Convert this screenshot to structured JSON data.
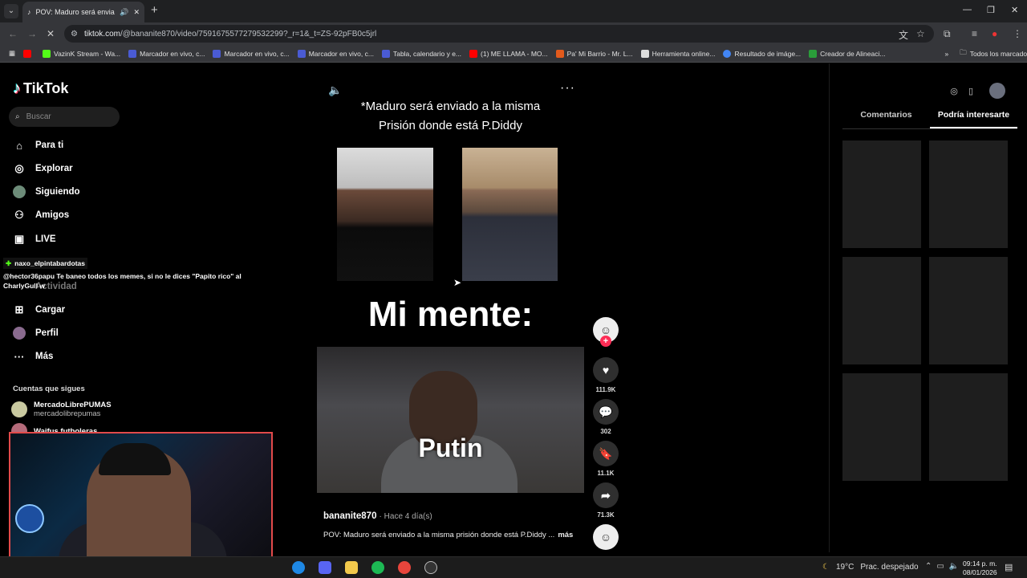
{
  "browser": {
    "tab_title": "POV: Maduro será enviado",
    "url_host": "tiktok.com",
    "url_path": "/@bananite870/video/7591675577279532299?_r=1&_t=ZS-92pFB0c5jrl",
    "bookmarks": [
      {
        "label": "",
        "color": "#ff0000"
      },
      {
        "label": "VazinK Stream - Wa...",
        "color": "#53fc18"
      },
      {
        "label": "Marcador en vivo, c...",
        "color": "#4a5bd4"
      },
      {
        "label": "Marcador en vivo, c...",
        "color": "#4a5bd4"
      },
      {
        "label": "Marcador en vivo, c...",
        "color": "#4a5bd4"
      },
      {
        "label": "Tabla, calendario y e...",
        "color": "#4a5bd4"
      },
      {
        "label": "(1) ME LLAMA - MO...",
        "color": "#ff0000"
      },
      {
        "label": "Pa' Mi Barrio - Mr. L...",
        "color": "#e25a1c"
      },
      {
        "label": "Herramienta online...",
        "color": "#dddddd"
      },
      {
        "label": "Resultado de imáge...",
        "color": "#4285f4"
      },
      {
        "label": "Creador de Alineaci...",
        "color": "#2a9d3a"
      }
    ],
    "all_bookmarks": "Todos los marcadores"
  },
  "tiktok": {
    "logo": "TikTok",
    "search_placeholder": "Buscar",
    "nav": [
      {
        "label": "Para ti",
        "icon": "home-icon"
      },
      {
        "label": "Explorar",
        "icon": "compass-icon"
      },
      {
        "label": "Siguiendo",
        "icon": "following-avatar-icon"
      },
      {
        "label": "Amigos",
        "icon": "friends-icon"
      },
      {
        "label": "LIVE",
        "icon": "live-icon"
      },
      {
        "label": "Actividad",
        "icon": "activity-icon"
      },
      {
        "label": "Cargar",
        "icon": "upload-icon"
      },
      {
        "label": "Perfil",
        "icon": "profile-icon"
      },
      {
        "label": "Más",
        "icon": "more-icon"
      }
    ],
    "following_title": "Cuentas que sigues",
    "following": [
      {
        "name": "MercadoLibrePUMAS",
        "handle": "mercadolibrepumas"
      },
      {
        "name": "Waifus futboleras",
        "handle": ""
      }
    ],
    "chat": {
      "user": "naxo_elpintabardotas",
      "message_line1": "@hector36papu Te baneo todos los memes, si no le dices \"Papito rico\" al",
      "message_line2": "CharlyGull w"
    },
    "video": {
      "title_line1": "*Maduro será enviado a la misma",
      "title_line2": "Prisión donde está P.Diddy",
      "mente": "Mi mente:",
      "putin": "Putin"
    },
    "actions": {
      "likes": "111.9K",
      "comments": "302",
      "saves": "11.1K",
      "shares": "71.3K"
    },
    "caption": {
      "user": "bananite870",
      "when": "· Hace 4 día(s)",
      "desc": "POV: Maduro será enviado a la misma prisión donde está P.Diddy ...",
      "more": "más"
    },
    "right_tabs": [
      "Comentarios",
      "Podría interesarte"
    ]
  },
  "taskbar": {
    "temperature": "19°C",
    "weather": "Prac. despejado",
    "time": "09:14 p. m.",
    "date": "08/01/2026"
  }
}
